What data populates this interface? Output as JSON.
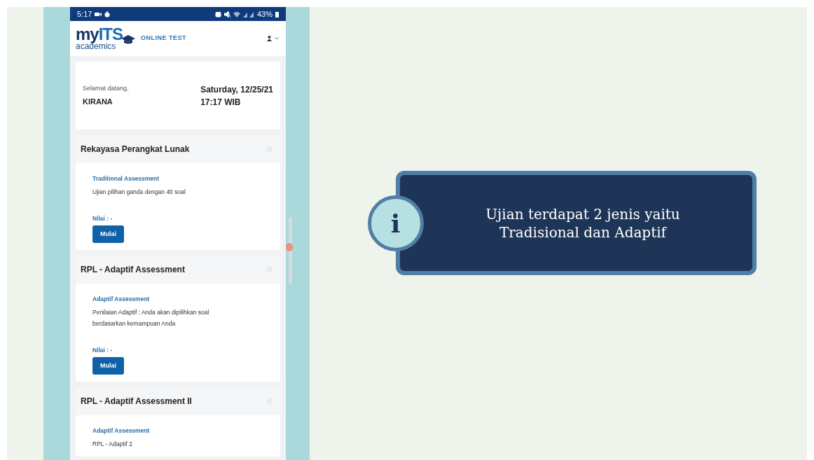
{
  "status_bar": {
    "time": "5:17",
    "battery": "43%"
  },
  "header": {
    "logo_part_1": "my",
    "logo_part_2": "ITS",
    "logo_subtitle": "academics",
    "app_title": "ONLINE TEST"
  },
  "welcome": {
    "greeting": "Selamat datang,",
    "name": "KIRANA",
    "date": "Saturday, 12/25/21",
    "time": "17:17 WIB"
  },
  "courses": [
    {
      "title": "Rekayasa Perangkat Lunak",
      "type": "Traditional Assessment",
      "description": "Ujian pilihan ganda dengan 40 soal",
      "score": "Nilai : -",
      "button": "Mulai"
    },
    {
      "title": "RPL - Adaptif Assessment",
      "type": "Adaptif Assessment",
      "description": "Penilaian Adaptif : Anda akan dipilihkan soal berdasarkan kemampuan Anda",
      "score": "Nilai : -",
      "button": "Mulai"
    },
    {
      "title": "RPL - Adaptif Assessment II",
      "type": "Adaptif Assessment",
      "description": "RPL - Adaptif 2"
    }
  ],
  "callout": {
    "icon": "i",
    "lines": [
      "Ujian terdapat 2 jenis yaitu",
      "Tradisional dan Adaptif"
    ]
  }
}
